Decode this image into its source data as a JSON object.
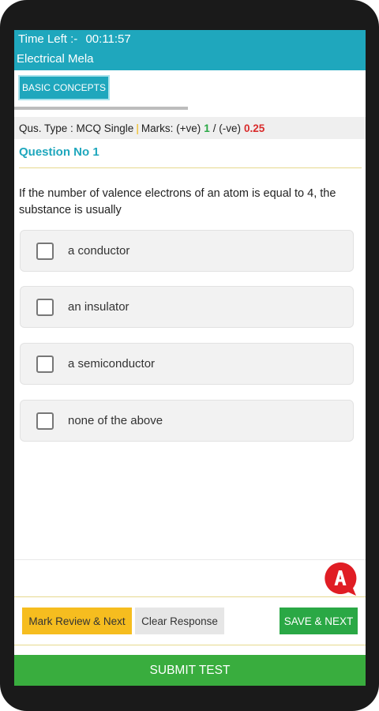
{
  "header": {
    "timer_label": "Time Left :-",
    "timer_value": "00:11:57",
    "app_title": "Electrical Mela"
  },
  "category_tab": "BASIC CONCEPTS",
  "info_bar": {
    "type_text": "Qus. Type : MCQ Single",
    "separator": "|",
    "marks_label": "Marks: (+ve)",
    "positive": "1",
    "slash": "/ (-ve)",
    "negative": "0.25"
  },
  "question": {
    "number_label": "Question No 1",
    "text": "If the number of valence electrons of an atom is equal to 4, the substance is usually",
    "options": [
      "a conductor",
      "an insulator",
      "a semiconductor",
      "none of the above"
    ]
  },
  "actions": {
    "review": "Mark Review & Next",
    "clear": "Clear Response",
    "save": "SAVE & NEXT",
    "submit": "SUBMIT TEST"
  },
  "colors": {
    "primary": "#1fa7bd",
    "positive": "#2aa845",
    "negative": "#d92b2b",
    "review": "#f6bd1f",
    "brand_icon": "#e01d24"
  },
  "icons": {
    "brand": "letter-a-chat-bubble-icon",
    "checkbox": "empty-checkbox-icon"
  }
}
